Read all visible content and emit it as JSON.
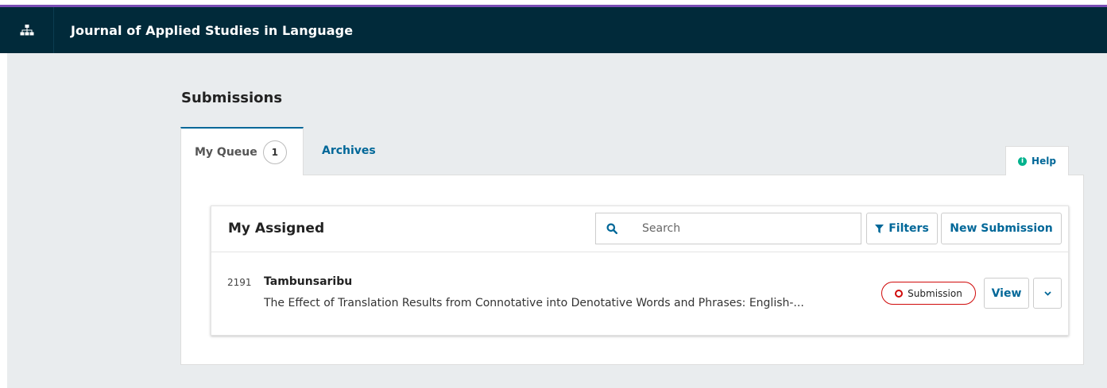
{
  "header": {
    "site_title": "Journal of Applied Studies in Language",
    "sitemap_icon": "sitemap-icon"
  },
  "page": {
    "title": "Submissions"
  },
  "tabs": [
    {
      "label": "My Queue",
      "count": "1",
      "active": true
    },
    {
      "label": "Archives",
      "active": false
    }
  ],
  "help": {
    "label": "Help",
    "icon": "info-circle-icon"
  },
  "list": {
    "title": "My Assigned",
    "search_placeholder": "Search",
    "filters_label": "Filters",
    "new_submission_label": "New Submission",
    "items": [
      {
        "id": "2191",
        "author": "Tambunsaribu",
        "title": "The Effect of Translation Results from Connotative into Denotative Words and Phrases: English-...",
        "stage": "Submission",
        "view_label": "View"
      }
    ]
  },
  "colors": {
    "header_bg": "#012a3a",
    "accent": "#006798",
    "top_bar": "#7b4db5",
    "stage_red": "#d00a0a",
    "help_green": "#00b28d",
    "page_bg": "#e9ecee"
  }
}
